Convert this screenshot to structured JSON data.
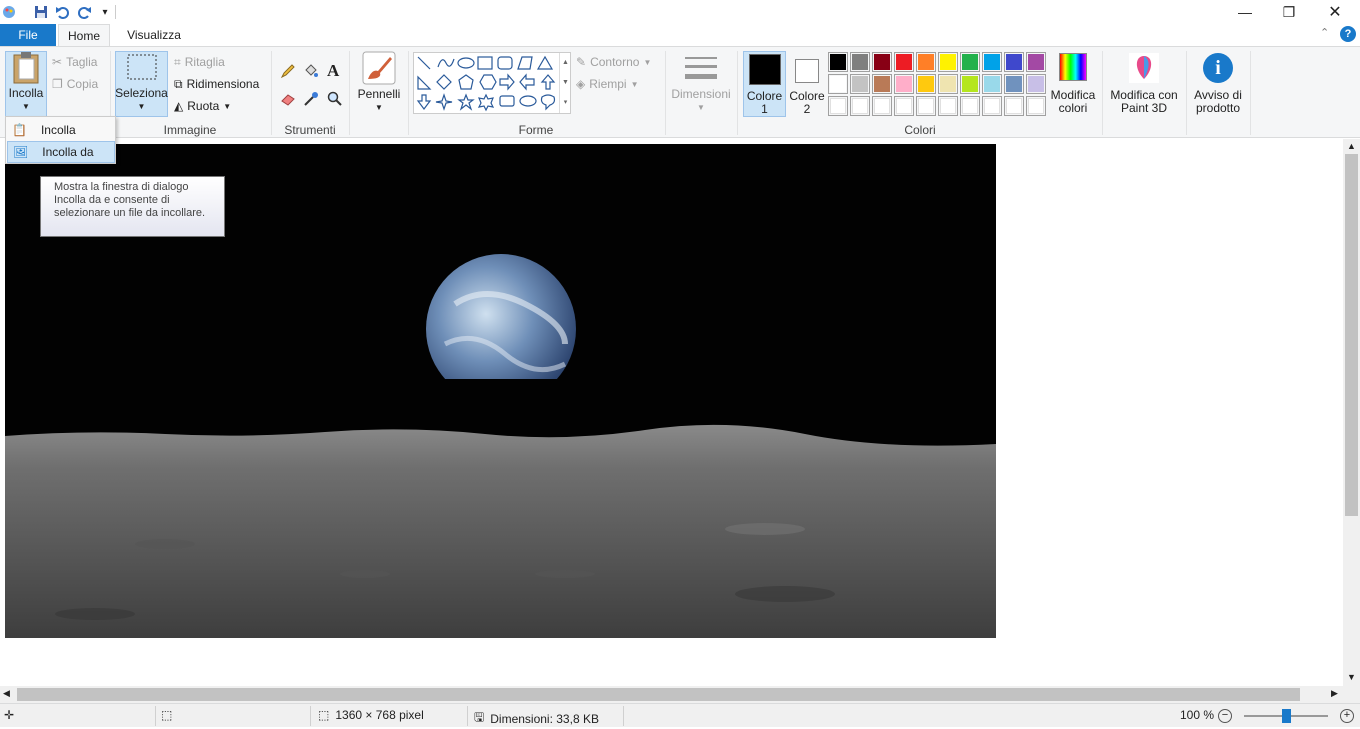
{
  "tabs": {
    "file": "File",
    "home": "Home",
    "view": "Visualizza"
  },
  "clipboard": {
    "paste": "Incolla",
    "cut": "Taglia",
    "copy": "Copia"
  },
  "image": {
    "select": "Seleziona",
    "crop": "Ritaglia",
    "resize": "Ridimensiona",
    "rotate": "Ruota",
    "group": "Immagine"
  },
  "tools": {
    "group": "Strumenti"
  },
  "brushes": {
    "label": "Pennelli"
  },
  "shapes": {
    "outline": "Contorno",
    "fill": "Riempi",
    "group": "Forme"
  },
  "size": {
    "label": "Dimensioni"
  },
  "colors": {
    "color1_a": "Colore",
    "color1_b": "1",
    "color2_a": "Colore",
    "color2_b": "2",
    "edit_a": "Modifica",
    "edit_b": "colori",
    "group": "Colori",
    "palette_row1": [
      "#000000",
      "#7f7f7f",
      "#880015",
      "#ed1c24",
      "#ff7f27",
      "#fff200",
      "#22b14c",
      "#00a2e8",
      "#3f48cc",
      "#a349a4"
    ],
    "palette_row2": [
      "#ffffff",
      "#c3c3c3",
      "#b97a57",
      "#ffaec9",
      "#ffc90e",
      "#efe4b0",
      "#b5e61d",
      "#99d9ea",
      "#7092be",
      "#c8bfe7"
    ],
    "palette_row3": [
      "#ffffff",
      "#ffffff",
      "#ffffff",
      "#ffffff",
      "#ffffff",
      "#ffffff",
      "#ffffff",
      "#ffffff",
      "#ffffff",
      "#ffffff"
    ]
  },
  "paint3d": {
    "a": "Modifica con",
    "b": "Paint 3D"
  },
  "notice": {
    "a": "Avviso di",
    "b": "prodotto"
  },
  "dropdown": {
    "item1": "Incolla",
    "item2": "Incolla da"
  },
  "tooltip": "Mostra la finestra di dialogo Incolla da e consente di selezionare un file da incollare.",
  "status": {
    "dimensions": "1360 × 768 pixel",
    "filesize": "Dimensioni: 33,8 KB",
    "zoom": "100 %"
  }
}
